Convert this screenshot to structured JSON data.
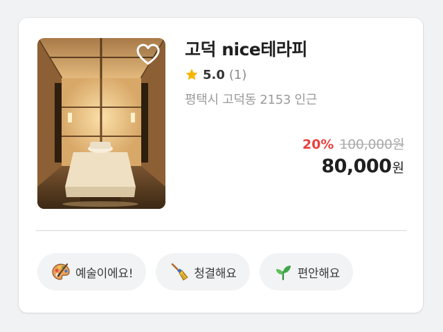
{
  "shop": {
    "name": "고덕 nice테라피",
    "rating": "5.0",
    "review_count": "(1)",
    "address": "평택시 고덕동 2153 인근",
    "favorited": false,
    "image": "spa-massage-room-photo"
  },
  "price": {
    "discount": "20%",
    "original": "100,000원",
    "sale_amount": "80,000",
    "sale_unit": "원"
  },
  "tags": [
    {
      "icon": "artist-palette-icon",
      "label": "예술이에요!"
    },
    {
      "icon": "broom-icon",
      "label": "청결해요"
    },
    {
      "icon": "seedling-icon",
      "label": "편안해요"
    }
  ],
  "colors": {
    "discount": "#e8413f",
    "star": "#f7b500",
    "tag_background": "#f2f3f5",
    "card_background": "#ffffff",
    "page_background": "#f1f2f4"
  }
}
